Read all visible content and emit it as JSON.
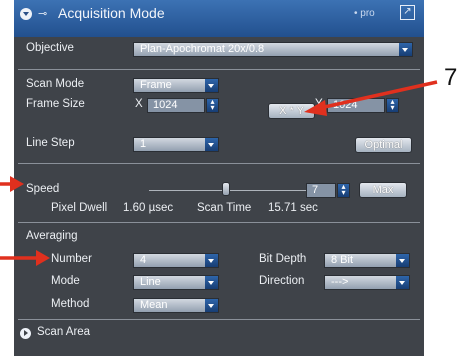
{
  "panel": {
    "title": "Acquisition Mode",
    "pro_label": "• pro",
    "pin_glyph": "⊸",
    "popout_glyph": "↗"
  },
  "objective": {
    "label": "Objective",
    "value": "Plan-Apochromat 20x/0.8"
  },
  "scan_mode": {
    "label": "Scan Mode",
    "value": "Frame"
  },
  "frame_size": {
    "label": "Frame Size",
    "x_label": "X",
    "x_value": "1024",
    "y_label": "Y",
    "y_value": "1024",
    "xy_button": "X * Y",
    "optimal_button": "Optimal"
  },
  "line_step": {
    "label": "Line Step",
    "value": "1"
  },
  "speed": {
    "label": "Speed",
    "value": "7",
    "max_button": "Max",
    "slider_level": 0.45
  },
  "pixel_dwell": {
    "label": "Pixel Dwell",
    "value": "1.60 µsec"
  },
  "scan_time": {
    "label": "Scan Time",
    "value": "15.71 sec"
  },
  "averaging": {
    "header": "Averaging",
    "number_label": "Number",
    "number_value": "4",
    "mode_label": "Mode",
    "mode_value": "Line",
    "method_label": "Method",
    "method_value": "Mean",
    "bit_depth_label": "Bit Depth",
    "bit_depth_value": "8 Bit",
    "direction_label": "Direction",
    "direction_value": "--->"
  },
  "scan_area": {
    "label": "Scan Area"
  },
  "annotation": {
    "number": "7",
    "arrow_color": "#e0301e"
  },
  "colors": {
    "panel_bg": "#3f4349",
    "title_bar": "#2d5f9f",
    "accent_blue": "#1f4f8f"
  }
}
